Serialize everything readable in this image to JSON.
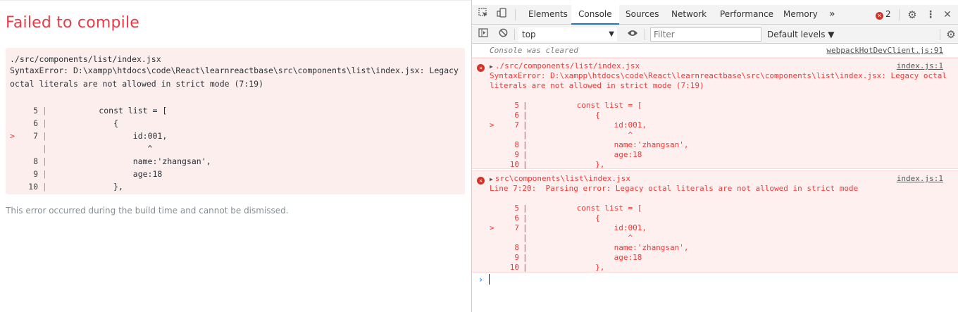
{
  "overlay": {
    "title": "Failed to compile",
    "file": "./src/components/list/index.jsx",
    "error_line1": "SyntaxError: D:\\xampp\\htdocs\\code\\React\\learnreactbase\\src\\components\\list\\index.jsx: Legacy",
    "error_line2": "octal literals are not allowed in strict mode (7:19)",
    "frame": [
      {
        "marker": "",
        "num": "5",
        "gutter": "|",
        "code": "         const list = ["
      },
      {
        "marker": "",
        "num": "6",
        "gutter": "|",
        "code": "            {"
      },
      {
        "marker": ">",
        "num": "7",
        "gutter": "|",
        "code": "                id:",
        "num_token": "001",
        "tail": ","
      },
      {
        "marker": "",
        "num": "",
        "gutter": "|",
        "code": "                   ^"
      },
      {
        "marker": "",
        "num": "8",
        "gutter": "|",
        "code": "                name:",
        "str_token": "'zhangsan'",
        "tail": ","
      },
      {
        "marker": "",
        "num": "9",
        "gutter": "|",
        "code": "                age:",
        "num_token": "18"
      },
      {
        "marker": "",
        "num": "10",
        "gutter": "|",
        "code": "            },"
      }
    ],
    "footnote": "This error occurred during the build time and cannot be dismissed."
  },
  "devtools": {
    "tabs": [
      "Elements",
      "Console",
      "Sources",
      "Network",
      "Performance",
      "Memory"
    ],
    "active_tab": "Console",
    "more_tabs_icon": "»",
    "error_count": "2",
    "context": "top",
    "filter_placeholder": "Filter",
    "levels": "Default levels ▼",
    "cleared_text": "Console was cleared",
    "cleared_source": "webpackHotDevClient.js:91",
    "messages": [
      {
        "title": "./src/components/list/index.jsx",
        "source": "index.js:1",
        "detail1": "SyntaxError: D:\\xampp\\htdocs\\code\\React\\learnreactbase\\src\\components\\list\\index.jsx: Legacy octal",
        "detail2": "literals are not allowed in strict mode (7:19)"
      },
      {
        "title": "src\\components\\list\\index.jsx",
        "source": "index.js:1",
        "detail1": "Line 7:20:  Parsing error: Legacy octal literals are not allowed in strict mode"
      }
    ],
    "frame": [
      {
        "marker": "",
        "num": "5",
        "gutter": "|",
        "code": "         const list = ["
      },
      {
        "marker": "",
        "num": "6",
        "gutter": "|",
        "code": "             {"
      },
      {
        "marker": ">",
        "num": "7",
        "gutter": "|",
        "code": "                 id:001,"
      },
      {
        "marker": "",
        "num": "",
        "gutter": "|",
        "code": "                    ^"
      },
      {
        "marker": "",
        "num": "8",
        "gutter": "|",
        "code": "                 name:'zhangsan',"
      },
      {
        "marker": "",
        "num": "9",
        "gutter": "|",
        "code": "                 age:18"
      },
      {
        "marker": "",
        "num": "10",
        "gutter": "|",
        "code": "             },"
      }
    ],
    "prompt": "›"
  },
  "colors": {
    "overlay_title": "#e83b46",
    "overlay_box": "#fdeeee",
    "console_error_text": "#ff3333",
    "console_error_bg": "#fff0f0",
    "active_tab_underline": "#1a73e8"
  }
}
